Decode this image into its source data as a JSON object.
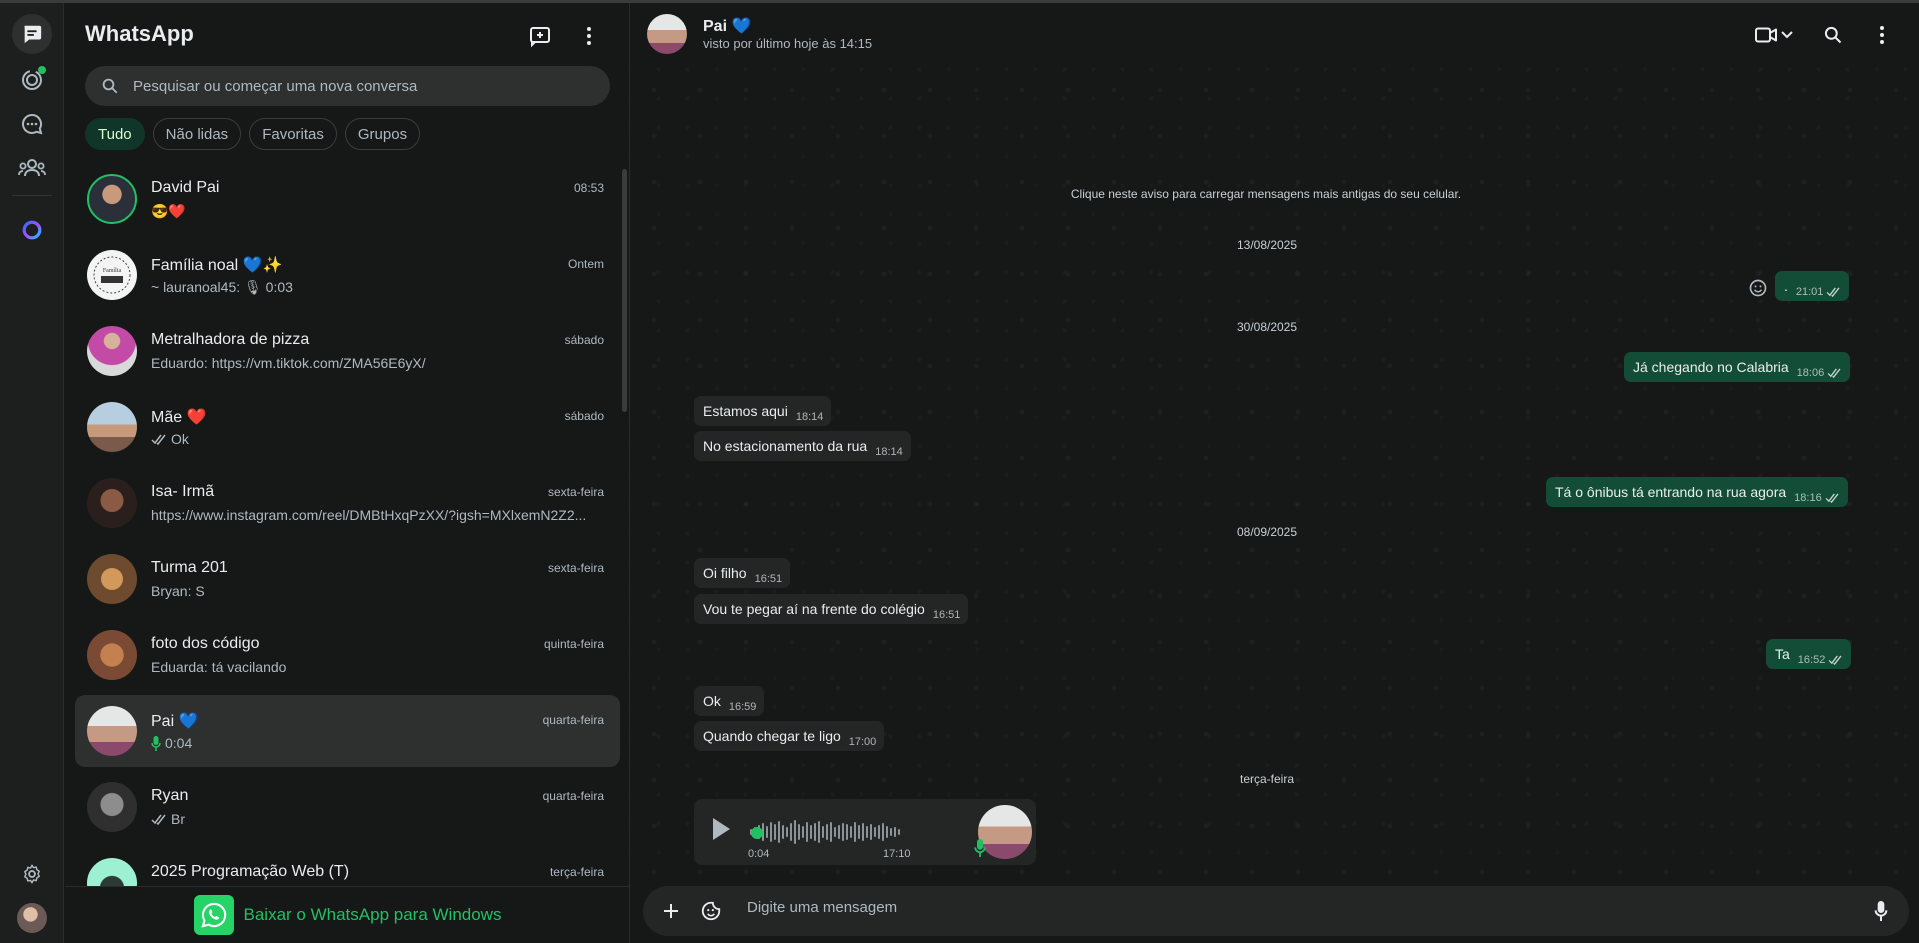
{
  "app": {
    "title": "WhatsApp"
  },
  "search": {
    "placeholder": "Pesquisar ou começar uma nova conversa"
  },
  "filters": [
    "Tudo",
    "Não lidas",
    "Favoritas",
    "Grupos"
  ],
  "chats": [
    {
      "name": "David Pai",
      "time": "08:53",
      "preview": "😎❤️",
      "preview_icon": ""
    },
    {
      "name": "Família noal 💙✨",
      "time": "Ontem",
      "preview": "~ lauranoal45: 🎙 0:03",
      "preview_icon": ""
    },
    {
      "name": "Metralhadora de pizza",
      "time": "sábado",
      "preview": "Eduardo: https://vm.tiktok.com/ZMA56E6yX/",
      "preview_icon": ""
    },
    {
      "name": "Mãe ❤️",
      "time": "sábado",
      "preview": "Ok",
      "preview_icon": "double-check-icon"
    },
    {
      "name": "Isa- Irmã",
      "time": "sexta-feira",
      "preview": "https://www.instagram.com/reel/DMBtHxqPzXX/?igsh=MXlxemN2Z2...",
      "preview_icon": ""
    },
    {
      "name": "Turma 201",
      "time": "sexta-feira",
      "preview": "Bryan: S",
      "preview_icon": ""
    },
    {
      "name": "foto dos código",
      "time": "quinta-feira",
      "preview": "Eduarda: tá vacilando",
      "preview_icon": ""
    },
    {
      "name": "Pai 💙",
      "time": "quarta-feira",
      "preview": "0:04",
      "preview_icon": "mic-icon"
    },
    {
      "name": "Ryan",
      "time": "quarta-feira",
      "preview": "Br",
      "preview_icon": "double-check-icon"
    },
    {
      "name": "2025 Programação Web (T)",
      "time": "terça-feira",
      "preview": "",
      "preview_icon": ""
    }
  ],
  "footer": {
    "label": "Baixar o WhatsApp para Windows"
  },
  "conversation": {
    "name": "Pai 💙",
    "status": "visto por último hoje às 14:15",
    "notice": "Clique neste aviso para carregar mensagens mais antigas do seu celular.",
    "dates": [
      "13/08/2025",
      "30/08/2025",
      "08/09/2025",
      "terça-feira"
    ],
    "messages": [
      {
        "text": ".",
        "time": "21:01",
        "dir": "out"
      },
      {
        "text": "Já chegando no Calabria",
        "time": "18:06",
        "dir": "out"
      },
      {
        "text": "Estamos aqui",
        "time": "18:14",
        "dir": "in"
      },
      {
        "text": "No estacionamento da rua",
        "time": "18:14",
        "dir": "in"
      },
      {
        "text": "Tá o ônibus tá entrando na rua agora",
        "time": "18:16",
        "dir": "out"
      },
      {
        "text": "Oi filho",
        "time": "16:51",
        "dir": "in"
      },
      {
        "text": "Vou te pegar aí na frente do colégio",
        "time": "16:51",
        "dir": "in"
      },
      {
        "text": "Ta",
        "time": "16:52",
        "dir": "out"
      },
      {
        "text": "Ok",
        "time": "16:59",
        "dir": "in"
      },
      {
        "text": "Quando chegar te ligo",
        "time": "17:00",
        "dir": "in"
      }
    ],
    "voice": {
      "duration": "0:04",
      "time": "17:10"
    }
  },
  "composer": {
    "placeholder": "Digite uma mensagem"
  },
  "colors": {
    "accent": "#21c063",
    "outgoing": "#144d37",
    "incoming": "#242626",
    "background": "#161717"
  }
}
